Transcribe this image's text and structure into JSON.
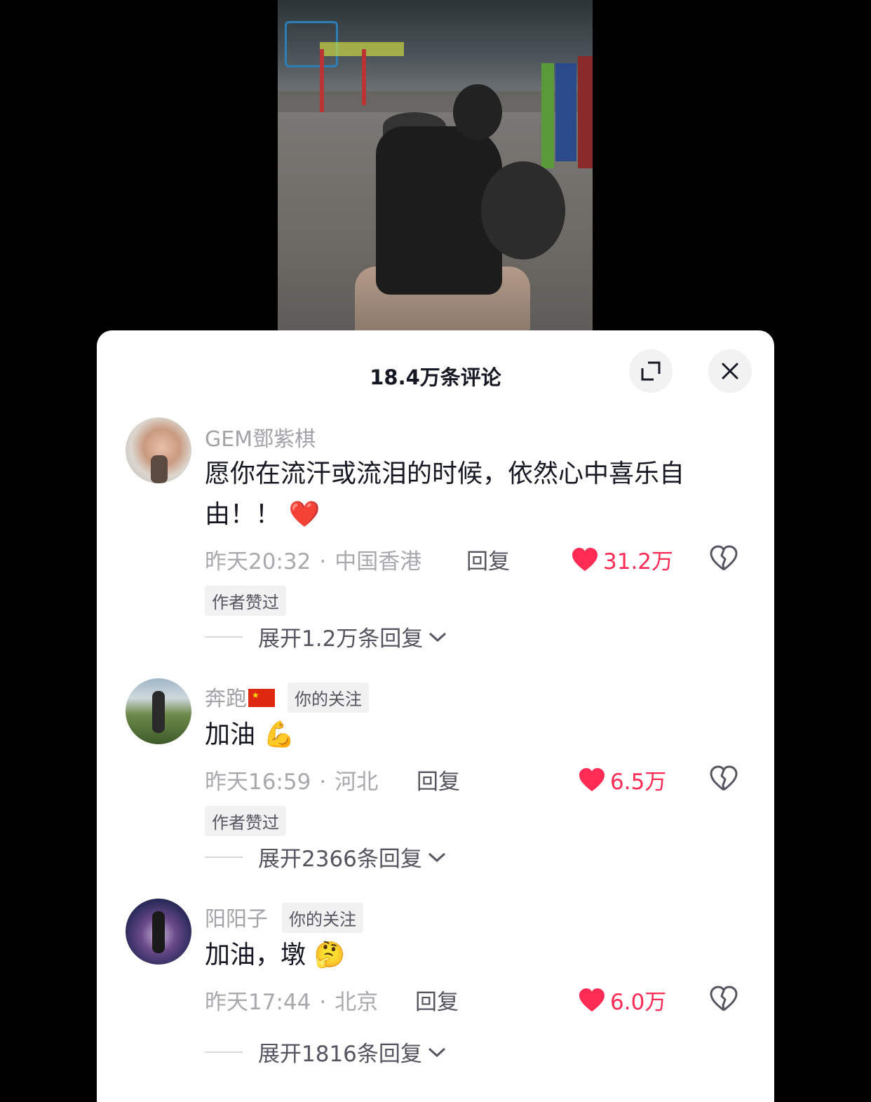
{
  "panel": {
    "title": "18.4万条评论"
  },
  "comments": [
    {
      "username": "GEM鄧紫棋",
      "follow_tag": "",
      "text": "愿你在流汗或流泪的时候，依然心中喜乐自由！！",
      "emoji": "❤️",
      "time": "昨天20:32",
      "location": "中国香港",
      "reply_label": "回复",
      "likes": "31.2万",
      "author_tag": "作者赞过",
      "expand_label": "展开1.2万条回复"
    },
    {
      "username": "奔跑",
      "follow_tag": "你的关注",
      "text": "加油",
      "emoji": "💪",
      "time": "昨天16:59",
      "location": "河北",
      "reply_label": "回复",
      "likes": "6.5万",
      "author_tag": "作者赞过",
      "expand_label": "展开2366条回复"
    },
    {
      "username": "阳阳子",
      "follow_tag": "你的关注",
      "text": "加油，墩",
      "emoji": "🤔",
      "time": "昨天17:44",
      "location": "北京",
      "reply_label": "回复",
      "likes": "6.0万",
      "author_tag": "",
      "expand_label": "展开1816条回复"
    }
  ],
  "icons": {
    "expand": "expand-icon",
    "close": "close-icon",
    "like": "heart-icon",
    "dislike": "broken-heart-icon",
    "chevron": "chevron-down-icon"
  },
  "colors": {
    "like_red": "#fe2c55",
    "muted_text": "#a8a9ad",
    "dark_text": "#161823"
  }
}
